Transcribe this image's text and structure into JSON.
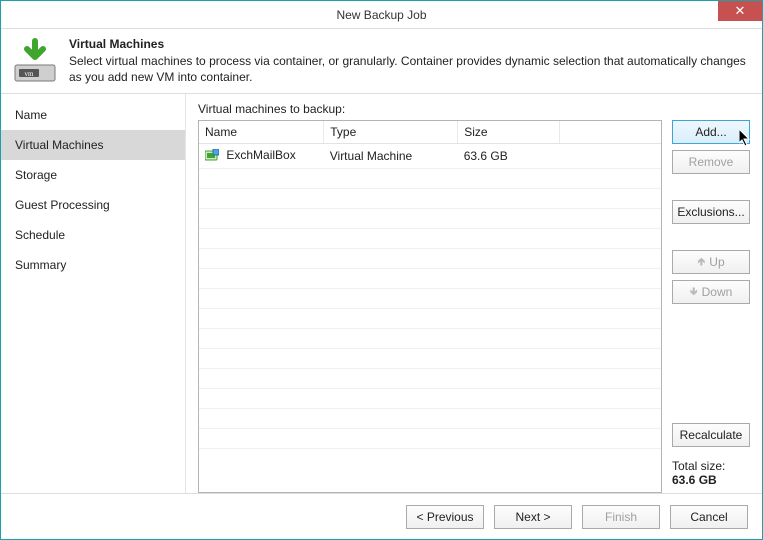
{
  "window": {
    "title": "New Backup Job"
  },
  "header": {
    "title": "Virtual Machines",
    "description": "Select virtual machines to process via container, or granularly. Container provides dynamic selection that automatically changes as you add new VM into container."
  },
  "sidebar": {
    "items": [
      {
        "label": "Name",
        "selected": false
      },
      {
        "label": "Virtual Machines",
        "selected": true
      },
      {
        "label": "Storage",
        "selected": false
      },
      {
        "label": "Guest Processing",
        "selected": false
      },
      {
        "label": "Schedule",
        "selected": false
      },
      {
        "label": "Summary",
        "selected": false
      }
    ]
  },
  "main": {
    "list_label": "Virtual machines to backup:",
    "columns": {
      "name": "Name",
      "type": "Type",
      "size": "Size"
    },
    "rows": [
      {
        "name": "ExchMailBox",
        "type": "Virtual Machine",
        "size": "63.6 GB"
      }
    ],
    "buttons": {
      "add": "Add...",
      "remove": "Remove",
      "exclusions": "Exclusions...",
      "up": "Up",
      "down": "Down",
      "recalculate": "Recalculate"
    },
    "total": {
      "label": "Total size:",
      "value": "63.6 GB"
    }
  },
  "footer": {
    "previous": "< Previous",
    "next": "Next >",
    "finish": "Finish",
    "cancel": "Cancel"
  }
}
